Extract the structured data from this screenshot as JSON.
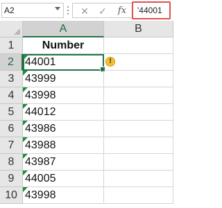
{
  "formula_bar": {
    "name_box": "A2",
    "cancel_icon": "✕",
    "enter_icon": "✓",
    "fx_label": "fx",
    "formula_value": "'44001"
  },
  "columns": [
    {
      "label": "A"
    },
    {
      "label": "B"
    }
  ],
  "rows": [
    {
      "num": "1",
      "a": "Number"
    },
    {
      "num": "2",
      "a": "44001"
    },
    {
      "num": "3",
      "a": "43999"
    },
    {
      "num": "4",
      "a": "43998"
    },
    {
      "num": "5",
      "a": "44012"
    },
    {
      "num": "6",
      "a": "43986"
    },
    {
      "num": "7",
      "a": "43988"
    },
    {
      "num": "8",
      "a": "43987"
    },
    {
      "num": "9",
      "a": "44005"
    },
    {
      "num": "10",
      "a": "43998"
    }
  ],
  "warning_icon": "!",
  "colors": {
    "selection": "#217346",
    "error_indicator": "#1e8a44",
    "formula_highlight": "#e0504f",
    "warning": "#f3c037"
  }
}
